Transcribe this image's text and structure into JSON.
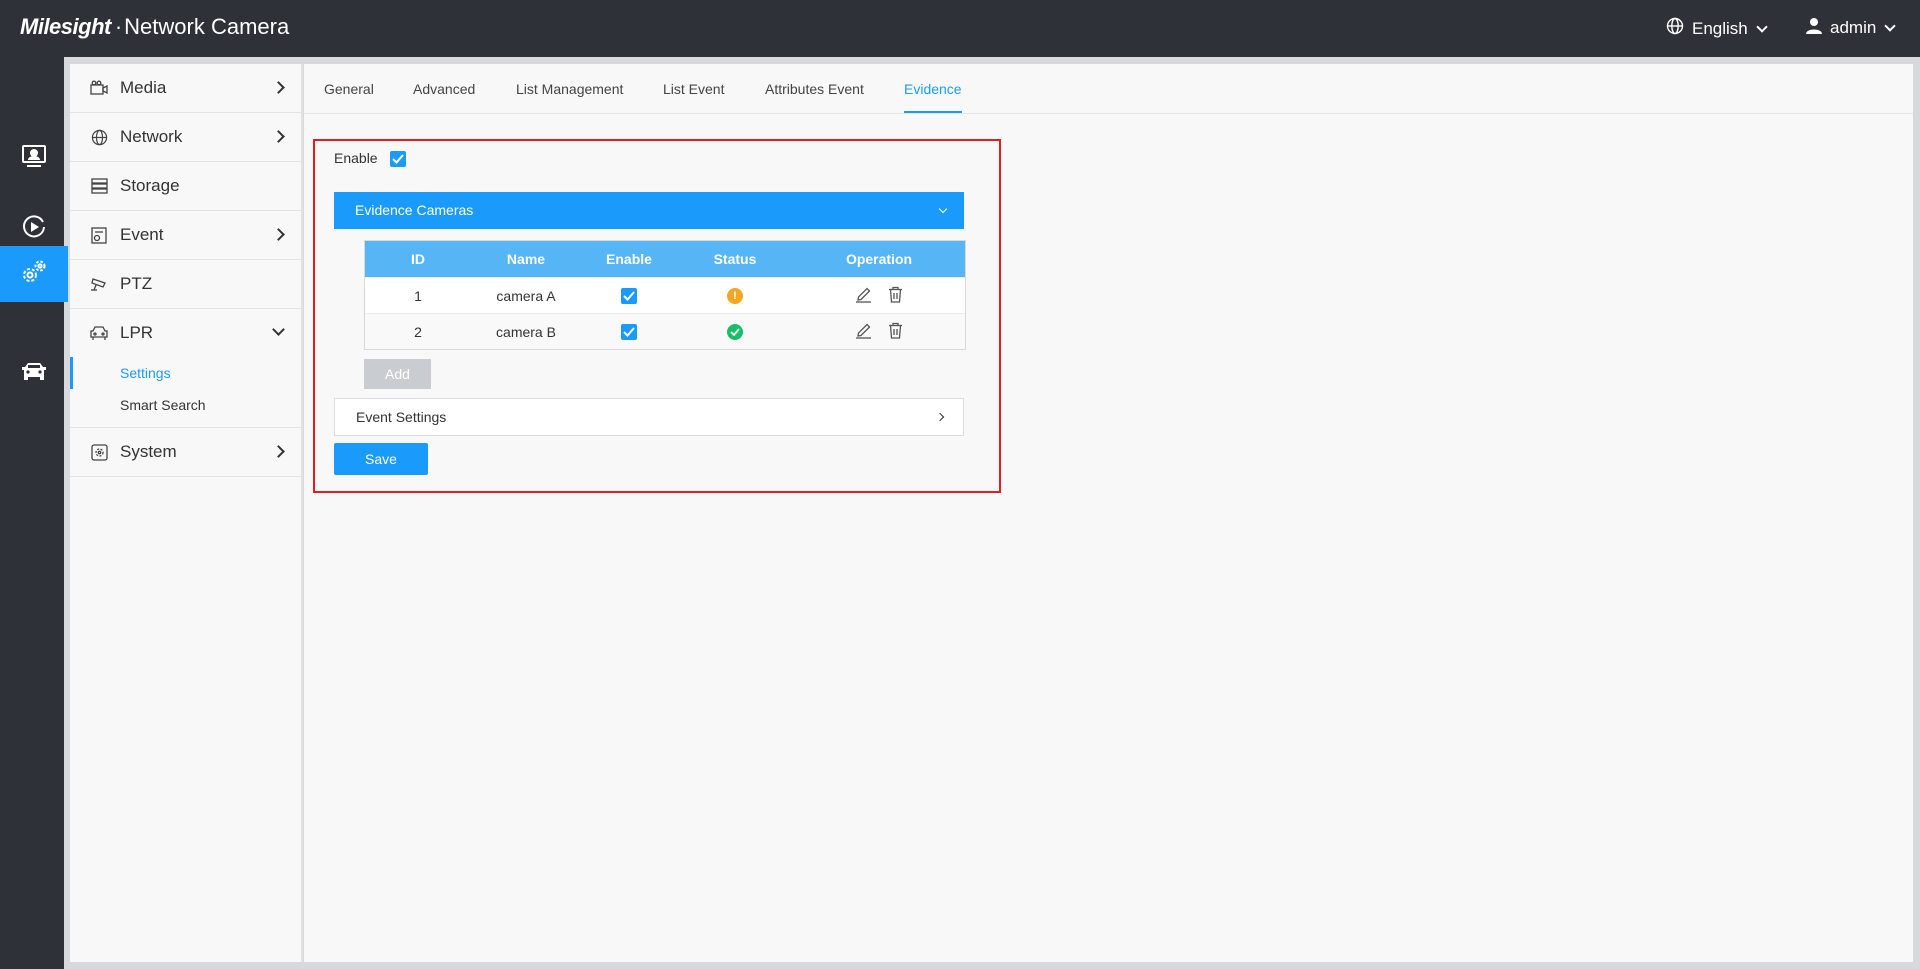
{
  "header": {
    "brand": "Milesight",
    "product": "Network Camera",
    "language": "English",
    "user": "admin"
  },
  "rail": {
    "items": [
      {
        "name": "live-view",
        "icon": "monitor-icon"
      },
      {
        "name": "playback",
        "icon": "play-circle-icon"
      },
      {
        "name": "settings",
        "icon": "gears-icon",
        "active": true
      },
      {
        "name": "lpr",
        "icon": "car-icon"
      }
    ]
  },
  "sidebar": {
    "items": [
      {
        "label": "Media",
        "icon": "camera-icon"
      },
      {
        "label": "Network",
        "icon": "globe-icon"
      },
      {
        "label": "Storage",
        "icon": "storage-icon"
      },
      {
        "label": "Event",
        "icon": "event-icon"
      },
      {
        "label": "PTZ",
        "icon": "ptz-icon"
      },
      {
        "label": "LPR",
        "icon": "car-icon"
      },
      {
        "label": "System",
        "icon": "system-icon"
      }
    ],
    "lpr_sub": [
      {
        "label": "Settings",
        "active": true
      },
      {
        "label": "Smart Search"
      }
    ]
  },
  "tabs": [
    "General",
    "Advanced",
    "List Management",
    "List Event",
    "Attributes Event",
    "Evidence"
  ],
  "active_tab": "Evidence",
  "evidence": {
    "enable_label": "Enable",
    "enabled": true,
    "panel_title": "Evidence Cameras",
    "columns": [
      "ID",
      "Name",
      "Enable",
      "Status",
      "Operation"
    ],
    "rows": [
      {
        "id": "1",
        "name": "camera A",
        "enabled": true,
        "status": "warning"
      },
      {
        "id": "2",
        "name": "camera B",
        "enabled": true,
        "status": "ok"
      }
    ],
    "add_label": "Add",
    "event_settings_label": "Event Settings",
    "save_label": "Save"
  },
  "colors": {
    "accent": "#1a9bfc",
    "topbar": "#2e3137",
    "table_header": "#56b5f5",
    "status_warning": "#f5a623",
    "status_ok": "#19be6b",
    "highlight_box": "#e02020"
  }
}
